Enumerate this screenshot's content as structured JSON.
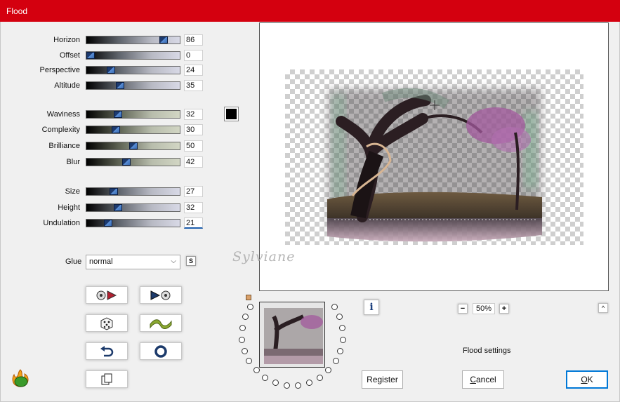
{
  "window": {
    "title": "Flood"
  },
  "params": [
    {
      "key": "horizon",
      "label": "Horizon",
      "value": "86",
      "fraction": 0.86
    },
    {
      "key": "offset",
      "label": "Offset",
      "value": "0",
      "fraction": 0.0
    },
    {
      "key": "perspective",
      "label": "Perspective",
      "value": "24",
      "fraction": 0.24
    },
    {
      "key": "altitude",
      "label": "Altitude",
      "value": "35",
      "fraction": 0.35
    },
    {
      "key": "waviness",
      "label": "Waviness",
      "value": "32",
      "fraction": 0.32
    },
    {
      "key": "complexity",
      "label": "Complexity",
      "value": "30",
      "fraction": 0.3
    },
    {
      "key": "brilliance",
      "label": "Brilliance",
      "value": "50",
      "fraction": 0.5
    },
    {
      "key": "blur",
      "label": "Blur",
      "value": "42",
      "fraction": 0.42
    },
    {
      "key": "size",
      "label": "Size",
      "value": "27",
      "fraction": 0.27
    },
    {
      "key": "height",
      "label": "Height",
      "value": "32",
      "fraction": 0.32
    },
    {
      "key": "undulation",
      "label": "Undulation",
      "value": "21",
      "fraction": 0.21
    }
  ],
  "color_swatch": {
    "color": "#000000"
  },
  "glue": {
    "label": "Glue",
    "value": "normal",
    "sync_label": "S"
  },
  "buttons": {
    "register": "Register",
    "cancel_rest": "ancel",
    "cancel_mnemonic": "C",
    "ok_rest": "K",
    "ok_mnemonic": "O"
  },
  "zoom": {
    "value": "50%"
  },
  "settings_label": "Flood settings",
  "watermark": "Sylviane",
  "colors": {
    "titlebar": "#d4000f",
    "accent": "#0078d7"
  }
}
